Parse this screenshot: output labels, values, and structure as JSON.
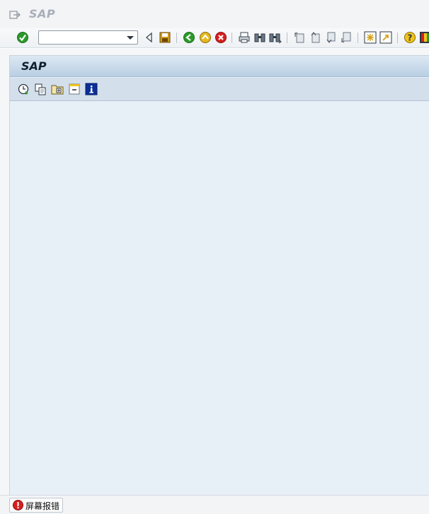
{
  "menubar": {
    "brand": "SAP",
    "menu_icon": "menu-exit-icon"
  },
  "toolbar": {
    "command_field": {
      "value": "",
      "placeholder": ""
    },
    "icons": [
      "enter-icon",
      "command-dropdown-icon",
      "collapse-arrow-icon",
      "save-icon",
      "back-icon",
      "exit-icon",
      "cancel-icon",
      "print-icon",
      "find-icon",
      "find-next-icon",
      "first-page-icon",
      "previous-page-icon",
      "next-page-icon",
      "last-page-icon",
      "create-session-icon",
      "shortcut-icon",
      "help-icon",
      "customize-layout-icon"
    ]
  },
  "screen": {
    "title": "SAP",
    "app_toolbar_icons": [
      "history-icon",
      "copy-icon",
      "add-favorite-icon",
      "delete-favorite-icon",
      "info-icon"
    ]
  },
  "statusbar": {
    "message": "屏幕报错",
    "type": "error"
  },
  "colors": {
    "work_area": "#e7eff7",
    "title_strip": "#c4d7ea",
    "error": "#d62020"
  }
}
